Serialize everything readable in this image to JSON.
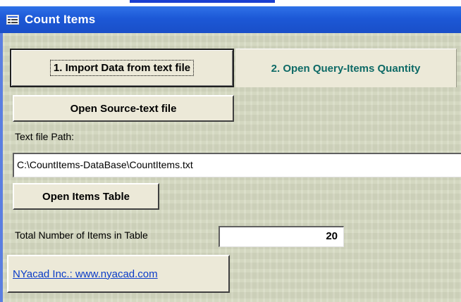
{
  "window": {
    "title": "Count Items"
  },
  "tabs": {
    "import_label": "1. Import Data from text file",
    "query_label": "2. Open Query-Items Quantity"
  },
  "buttons": {
    "open_source_label": "Open Source-text file",
    "open_items_table_label": "Open Items Table",
    "link_label": "NYacad Inc.: www.nyacad.com"
  },
  "fields": {
    "path_label": "Text file Path:",
    "path_value": "C:\\CountItems-DataBase\\CountItems.txt",
    "count_label": "Total Number of Items in Table",
    "count_value": "20"
  },
  "colors": {
    "titlebar": "#1c58d6",
    "form_background": "#d6dac2",
    "tab2_text": "#0e6a66",
    "link": "#0b3cc8"
  },
  "icons": {
    "title_icon": "form-icon"
  }
}
